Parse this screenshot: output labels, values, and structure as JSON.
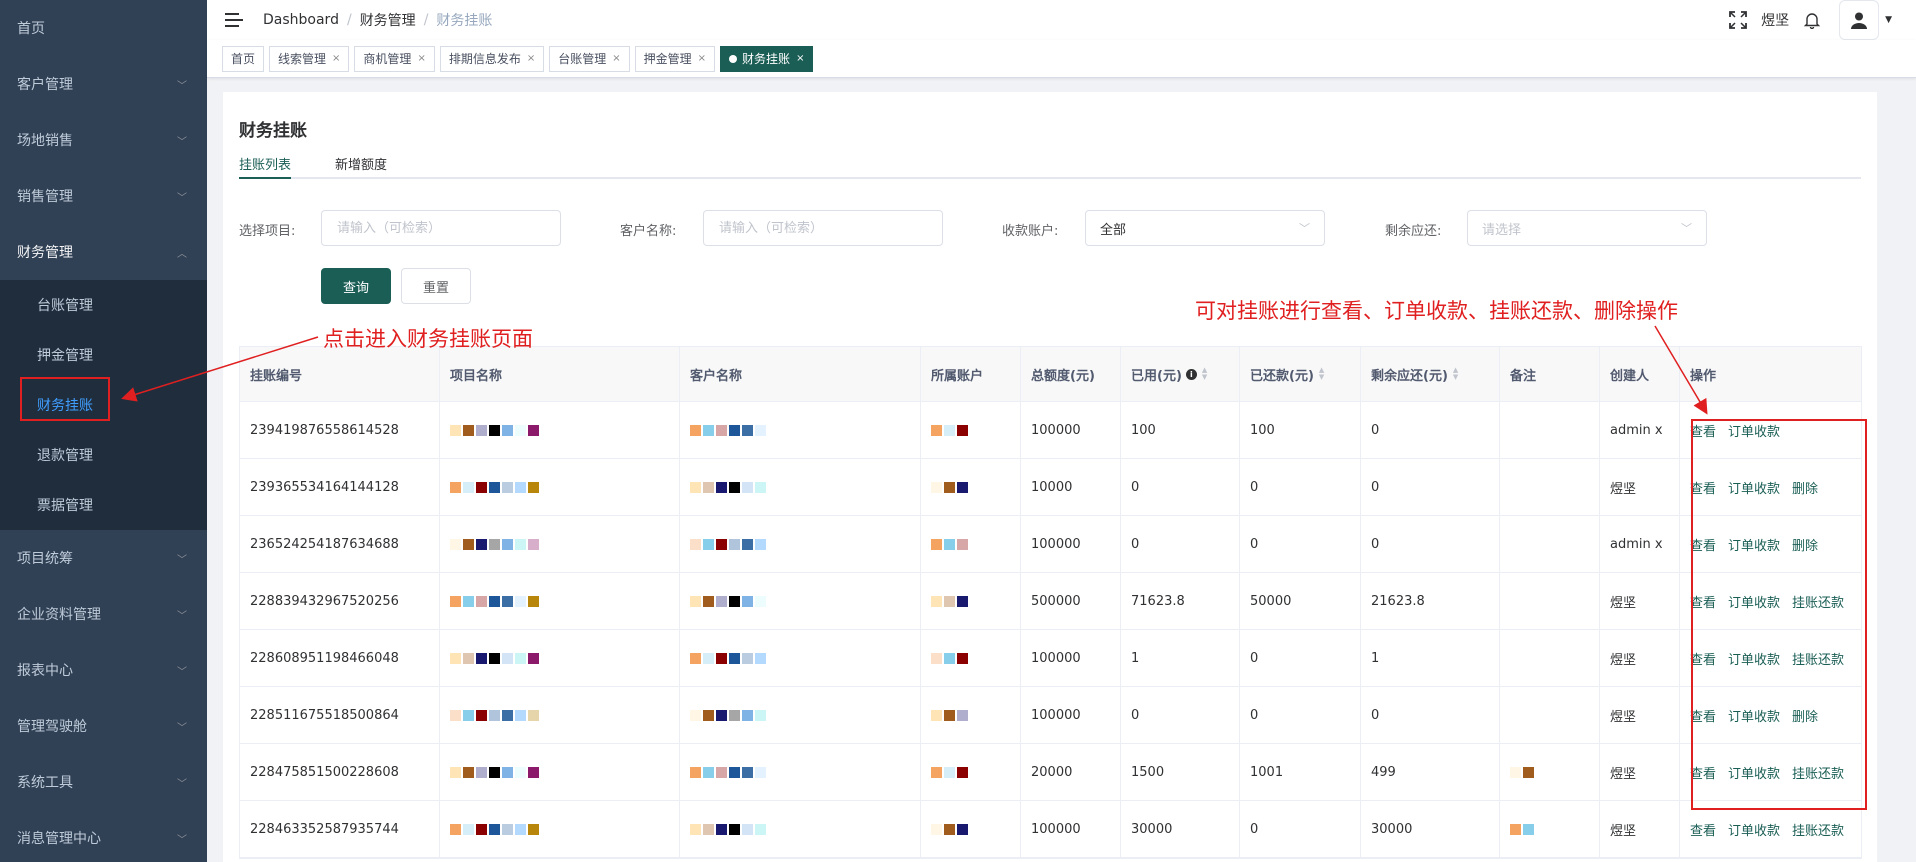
{
  "sidebar": {
    "items_top": [
      {
        "label": "首页",
        "arrow": false
      },
      {
        "label": "客户管理",
        "arrow": true
      },
      {
        "label": "场地销售",
        "arrow": true
      },
      {
        "label": "销售管理",
        "arrow": true
      }
    ],
    "open_group": {
      "label": "财务管理",
      "sub_items": [
        {
          "label": "台账管理",
          "active": false
        },
        {
          "label": "押金管理",
          "active": false
        },
        {
          "label": "财务挂账",
          "active": true
        },
        {
          "label": "退款管理",
          "active": false
        },
        {
          "label": "票据管理",
          "active": false
        }
      ]
    },
    "items_bottom": [
      {
        "label": "项目统筹"
      },
      {
        "label": "企业资料管理"
      },
      {
        "label": "报表中心"
      },
      {
        "label": "管理驾驶舱"
      },
      {
        "label": "系统工具"
      },
      {
        "label": "消息管理中心"
      }
    ]
  },
  "navbar": {
    "breadcrumb": [
      "Dashboard",
      "财务管理",
      "财务挂账"
    ],
    "user_name": "煜坚"
  },
  "tags": [
    {
      "label": "首页",
      "closable": false,
      "active": false
    },
    {
      "label": "线索管理",
      "closable": true,
      "active": false
    },
    {
      "label": "商机管理",
      "closable": true,
      "active": false
    },
    {
      "label": "排期信息发布",
      "closable": true,
      "active": false
    },
    {
      "label": "台账管理",
      "closable": true,
      "active": false
    },
    {
      "label": "押金管理",
      "closable": true,
      "active": false
    },
    {
      "label": "财务挂账",
      "closable": true,
      "active": true
    }
  ],
  "page": {
    "title": "财务挂账",
    "tabs": [
      "挂账列表",
      "新增额度"
    ]
  },
  "filters": {
    "project_label": "选择项目:",
    "project_placeholder": "请输入（可检索）",
    "customer_label": "客户名称:",
    "customer_placeholder": "请输入（可检索）",
    "account_label": "收款账户:",
    "account_value": "全部",
    "remaining_label": "剩余应还:",
    "remaining_placeholder": "请选择",
    "query_button": "查询",
    "reset_button": "重置"
  },
  "table": {
    "headers": [
      "挂账编号",
      "项目名称",
      "客户名称",
      "所属账户",
      "总额度(元)",
      "已用(元)",
      "已还款(元)",
      "剩余应还(元)",
      "备注",
      "创建人",
      "操作"
    ],
    "rows": [
      {
        "id": "239419876558614528",
        "total": "100000",
        "used": "100",
        "repaid": "100",
        "remaining": "0",
        "creator": "admin x",
        "ops": [
          "查看",
          "订单收款"
        ]
      },
      {
        "id": "239365534164144128",
        "total": "10000",
        "used": "0",
        "repaid": "0",
        "remaining": "0",
        "creator": "煜坚",
        "ops": [
          "查看",
          "订单收款",
          "删除"
        ]
      },
      {
        "id": "236524254187634688",
        "total": "100000",
        "used": "0",
        "repaid": "0",
        "remaining": "0",
        "creator": "admin x",
        "ops": [
          "查看",
          "订单收款",
          "删除"
        ]
      },
      {
        "id": "228839432967520256",
        "total": "500000",
        "used": "71623.8",
        "repaid": "50000",
        "remaining": "21623.8",
        "creator": "煜坚",
        "ops": [
          "查看",
          "订单收款",
          "挂账还款"
        ]
      },
      {
        "id": "228608951198466048",
        "total": "100000",
        "used": "1",
        "repaid": "0",
        "remaining": "1",
        "creator": "煜坚",
        "ops": [
          "查看",
          "订单收款",
          "挂账还款"
        ]
      },
      {
        "id": "228511675518500864",
        "total": "100000",
        "used": "0",
        "repaid": "0",
        "remaining": "0",
        "creator": "煜坚",
        "ops": [
          "查看",
          "订单收款",
          "删除"
        ]
      },
      {
        "id": "228475851500228608",
        "total": "20000",
        "used": "1500",
        "repaid": "1001",
        "remaining": "499",
        "creator": "煜坚",
        "ops": [
          "查看",
          "订单收款",
          "挂账还款"
        ]
      },
      {
        "id": "228463352587935744",
        "total": "100000",
        "used": "30000",
        "repaid": "0",
        "remaining": "30000",
        "creator": "煜坚",
        "ops": [
          "查看",
          "订单收款",
          "挂账还款"
        ]
      }
    ]
  },
  "annotations": {
    "sidebar_note": "点击进入财务挂账页面",
    "ops_note": "可对挂账进行查看、订单收款、挂账还款、删除操作",
    "color": "#e02020"
  },
  "colors": {
    "sidebar_bg": "#304156",
    "primary": "#1a5e55",
    "active_link": "#409eff"
  }
}
